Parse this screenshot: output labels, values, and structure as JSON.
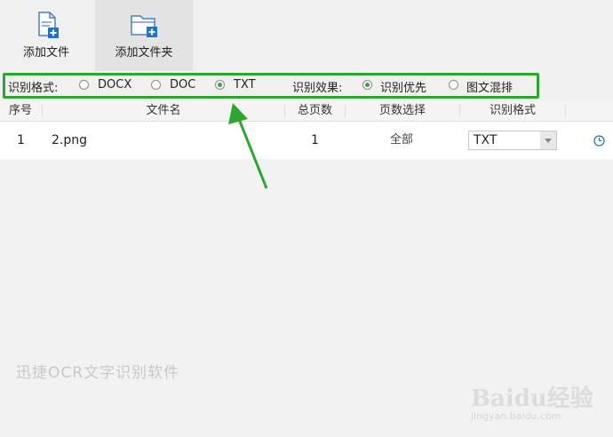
{
  "toolbar": {
    "add_file": "添加文件",
    "add_folder": "添加文件夹"
  },
  "options": {
    "format_label": "识别格式:",
    "formats": [
      "DOCX",
      "DOC",
      "TXT"
    ],
    "selected_format": "TXT",
    "effect_label": "识别效果:",
    "effects": [
      "识别优先",
      "图文混排"
    ],
    "selected_effect": "识别优先"
  },
  "table": {
    "headers": [
      "序号",
      "文件名",
      "总页数",
      "页数选择",
      "识别格式"
    ],
    "rows": [
      {
        "index": "1",
        "filename": "2.png",
        "pages": "1",
        "page_select": "全部",
        "format": "TXT"
      }
    ]
  },
  "watermark": "迅捷OCR文字识别软件",
  "baidu_logo": "Baidu经验",
  "baidu_url": "jingyan.baidu.com",
  "colors": {
    "highlight": "#2ea52e",
    "radio_on": "#3aa24a",
    "arrow": "#2ea52e",
    "icon_blue": "#1e73c8"
  }
}
